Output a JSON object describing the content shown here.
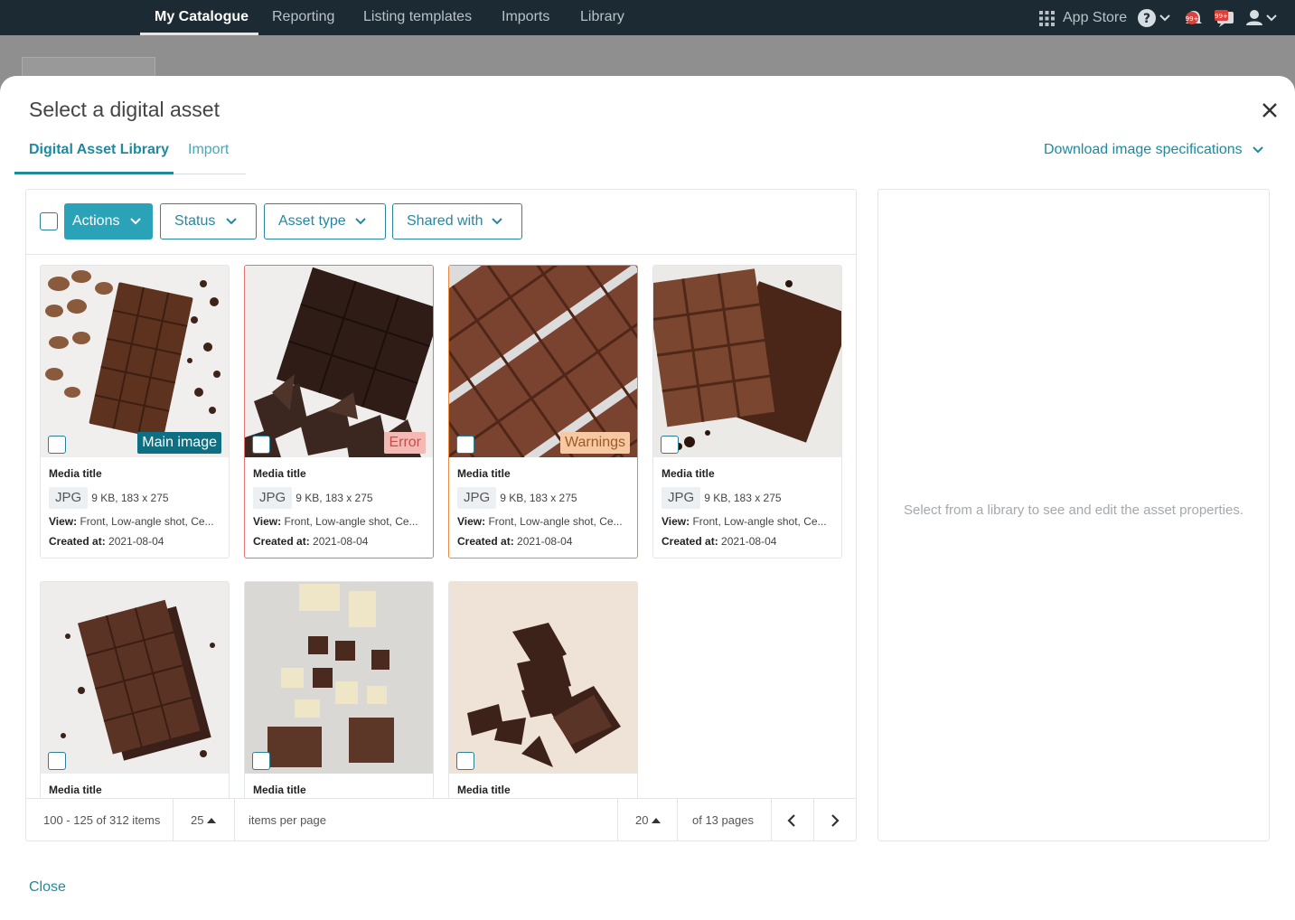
{
  "topnav": {
    "items": [
      "My Catalogue",
      "Reporting",
      "Listing templates",
      "Imports",
      "Library"
    ],
    "app_store": "App Store",
    "notification_count": "99+",
    "message_count": "99+"
  },
  "modal": {
    "title": "Select a digital asset",
    "tabs": [
      "Digital Asset Library",
      "Import"
    ],
    "download_spec": "Download image specifications",
    "close_link": "Close",
    "right_hint": "Select from a library to see and edit the asset properties."
  },
  "filters": {
    "actions": "Actions",
    "status": "Status",
    "asset_type": "Asset type",
    "shared_with": "Shared with"
  },
  "cards": [
    {
      "title": "Media title",
      "type": "JPG",
      "meta": "9 KB, 183 x 275",
      "view_label": "View:",
      "view": "Front, Low-angle shot, Ce...",
      "created_label": "Created at:",
      "created": "2021-08-04",
      "badge": "Main image"
    },
    {
      "title": "Media title",
      "type": "JPG",
      "meta": "9 KB, 183 x 275",
      "view_label": "View:",
      "view": "Front, Low-angle shot, Ce...",
      "created_label": "Created at:",
      "created": "2021-08-04",
      "badge": "Error"
    },
    {
      "title": "Media title",
      "type": "JPG",
      "meta": "9 KB, 183 x 275",
      "view_label": "View:",
      "view": "Front, Low-angle shot, Ce...",
      "created_label": "Created at:",
      "created": "2021-08-04",
      "badge": "Warnings"
    },
    {
      "title": "Media title",
      "type": "JPG",
      "meta": "9 KB, 183 x 275",
      "view_label": "View:",
      "view": "Front, Low-angle shot, Ce...",
      "created_label": "Created at:",
      "created": "2021-08-04",
      "badge": ""
    },
    {
      "title": "Media title"
    },
    {
      "title": "Media title"
    },
    {
      "title": "Media title"
    }
  ],
  "pager": {
    "range": "100 - 125 of 312 items",
    "per_page": "25",
    "per_page_label": "items per page",
    "current_page": "20",
    "total_pages": "of 13 pages"
  },
  "colors": {
    "accent": "#1e8aa0",
    "nav_bg": "#1b2a33",
    "error": "#e57373",
    "warning": "#e98a3d"
  }
}
